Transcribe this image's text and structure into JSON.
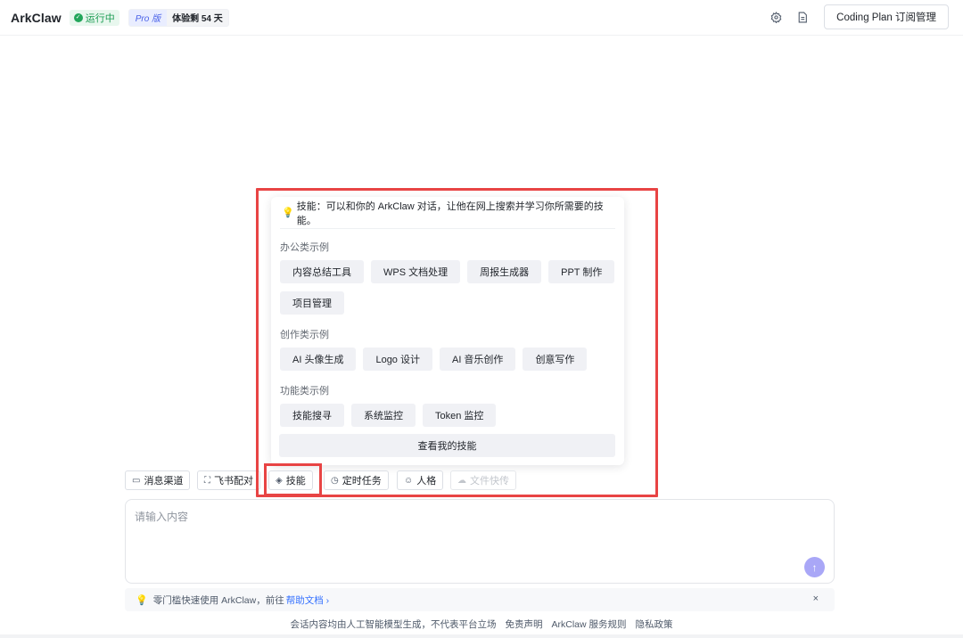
{
  "header": {
    "logo": "ArkClaw",
    "status": "运行中",
    "plan_label": "Pro 版",
    "trial_text": "体验剩 54 天",
    "settings_icon": "gear-icon",
    "doc_icon": "document-icon",
    "coding_plan_button": "Coding Plan 订阅管理"
  },
  "skill_popup": {
    "tip": "技能：可以和你的 ArkClaw 对话，让他在网上搜索并学习你所需要的技能。",
    "groups": [
      {
        "title": "办公类示例",
        "items": [
          "内容总结工具",
          "WPS 文档处理",
          "周报生成器",
          "PPT 制作",
          "项目管理"
        ]
      },
      {
        "title": "创作类示例",
        "items": [
          "AI 头像生成",
          "Logo 设计",
          "AI 音乐创作",
          "创意写作"
        ]
      },
      {
        "title": "功能类示例",
        "items": [
          "技能搜寻",
          "系统监控",
          "Token 监控"
        ]
      }
    ],
    "view_my_skills": "查看我的技能"
  },
  "toolbar": {
    "items": [
      {
        "label": "消息渠道",
        "icon": "message-icon",
        "enabled": true
      },
      {
        "label": "飞书配对",
        "icon": "scan-icon",
        "enabled": true
      },
      {
        "label": "技能",
        "icon": "layers-icon",
        "enabled": true
      },
      {
        "label": "定时任务",
        "icon": "alarm-icon",
        "enabled": true
      },
      {
        "label": "人格",
        "icon": "person-icon",
        "enabled": true
      },
      {
        "label": "文件快传",
        "icon": "cloud-upload-icon",
        "enabled": false
      }
    ]
  },
  "input": {
    "placeholder": "请输入内容",
    "send_icon": "arrow-up-icon"
  },
  "notice": {
    "text": "零门槛快速使用 ArkClaw，前往",
    "link": "帮助文档 ›",
    "close": "×"
  },
  "footer": {
    "disclaimer": "会话内容均由人工智能模型生成，不代表平台立场",
    "links": [
      "免责声明",
      "ArkClaw 服务规则",
      "隐私政策"
    ]
  },
  "colors": {
    "highlight": "#e84444",
    "accent_link": "#3370ff",
    "status_green": "#1a9b52",
    "send_button": "#a9a7f7"
  }
}
